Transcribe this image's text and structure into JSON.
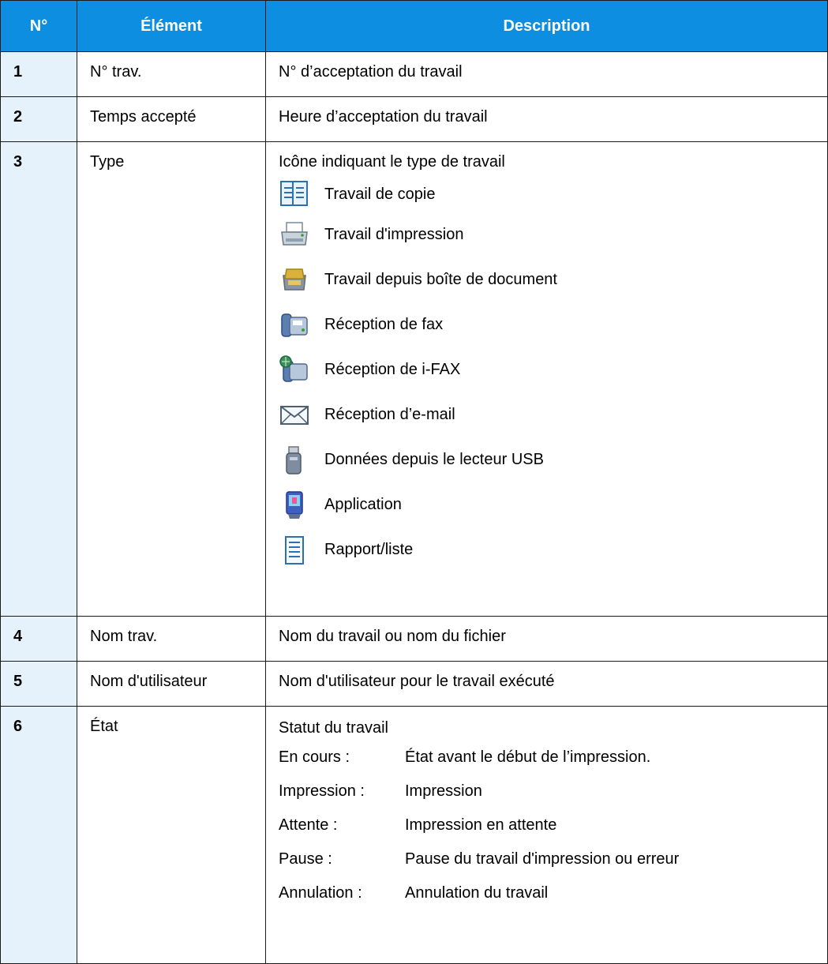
{
  "headers": {
    "num": "N°",
    "element": "Élément",
    "description": "Description"
  },
  "rows": [
    {
      "num": "1",
      "element": "N° trav.",
      "description": "N° d’acceptation du travail"
    },
    {
      "num": "2",
      "element": "Temps accepté",
      "description": "Heure d’acceptation du travail"
    },
    {
      "num": "3",
      "element": "Type",
      "description": "Icône indiquant le type de travail",
      "types": [
        {
          "icon": "copy-job-icon",
          "label": "Travail de copie"
        },
        {
          "icon": "print-job-icon",
          "label": "Travail d'impression"
        },
        {
          "icon": "document-box-job-icon",
          "label": "Travail depuis boîte de document"
        },
        {
          "icon": "fax-receive-icon",
          "label": "Réception de fax"
        },
        {
          "icon": "ifax-receive-icon",
          "label": "Réception de i-FAX"
        },
        {
          "icon": "email-receive-icon",
          "label": "Réception d’e-mail"
        },
        {
          "icon": "usb-drive-icon",
          "label": "Données depuis le lecteur USB"
        },
        {
          "icon": "application-icon",
          "label": "Application"
        },
        {
          "icon": "report-list-icon",
          "label": "Rapport/liste"
        }
      ]
    },
    {
      "num": "4",
      "element": "Nom trav.",
      "description": "Nom du travail ou nom du fichier"
    },
    {
      "num": "5",
      "element": "Nom d'utilisateur",
      "description": "Nom d'utilisateur pour le travail exécuté"
    },
    {
      "num": "6",
      "element": "État",
      "description": "Statut du travail",
      "statuses": [
        {
          "label": "En cours :",
          "text": "État avant le début de l’impression."
        },
        {
          "label": "Impression :",
          "text": "Impression"
        },
        {
          "label": "Attente :",
          "text": "Impression en attente"
        },
        {
          "label": "Pause :",
          "text": "Pause du travail d'impression ou erreur"
        },
        {
          "label": "Annulation :",
          "text": "Annulation du travail"
        }
      ]
    }
  ],
  "colors": {
    "header_bg": "#0d8ee0",
    "number_bg": "#e5f1fb",
    "border": "#1a1a1a"
  }
}
